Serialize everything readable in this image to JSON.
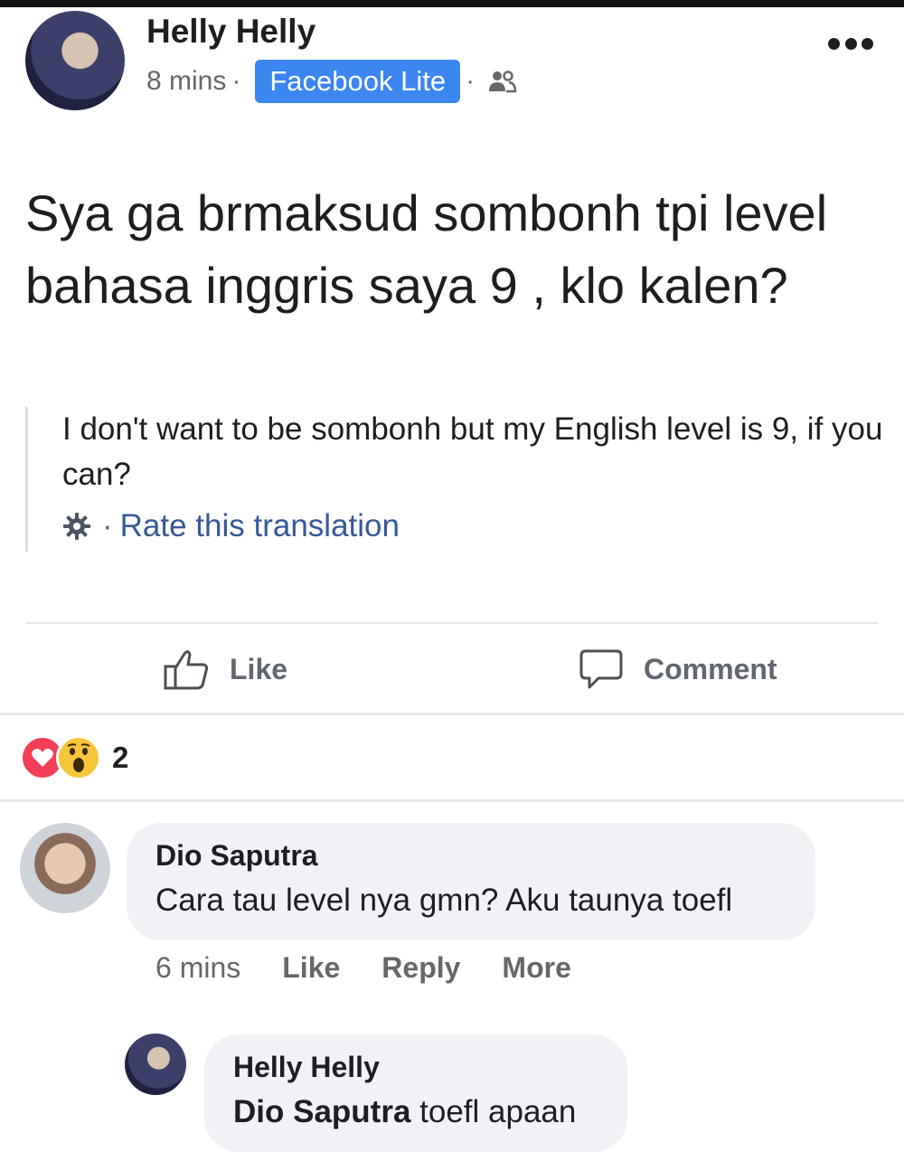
{
  "post": {
    "author": "Helly Helly",
    "time": "8 mins",
    "separator": "·",
    "app_badge": "Facebook Lite",
    "audience_separator": "·",
    "audience_icon": "friends-icon",
    "more_icon": "more-dots-icon",
    "text": "Sya ga brmaksud sombonh tpi level bahasa inggris saya 9 , klo kalen?",
    "translation": "I don't want to be sombonh but my English level is 9, if you can?",
    "rate_separator": "·",
    "rate_label": "Rate this translation"
  },
  "actions": {
    "like_label": "Like",
    "comment_label": "Comment"
  },
  "reactions": {
    "types": [
      "love",
      "wow"
    ],
    "count": "2"
  },
  "comments": [
    {
      "author": "Dio Saputra",
      "text": "Cara tau level nya gmn? Aku taunya toefl",
      "time": "6 mins",
      "like_label": "Like",
      "reply_label": "Reply",
      "more_label": "More"
    }
  ],
  "reply": {
    "author": "Helly Helly",
    "mention": "Dio Saputra",
    "text": " toefl apaan"
  },
  "colors": {
    "badge": "#3b86f0",
    "link": "#385898",
    "bubble": "#f0f2f5",
    "heart": "#f33e58",
    "wow": "#f7c53a"
  }
}
